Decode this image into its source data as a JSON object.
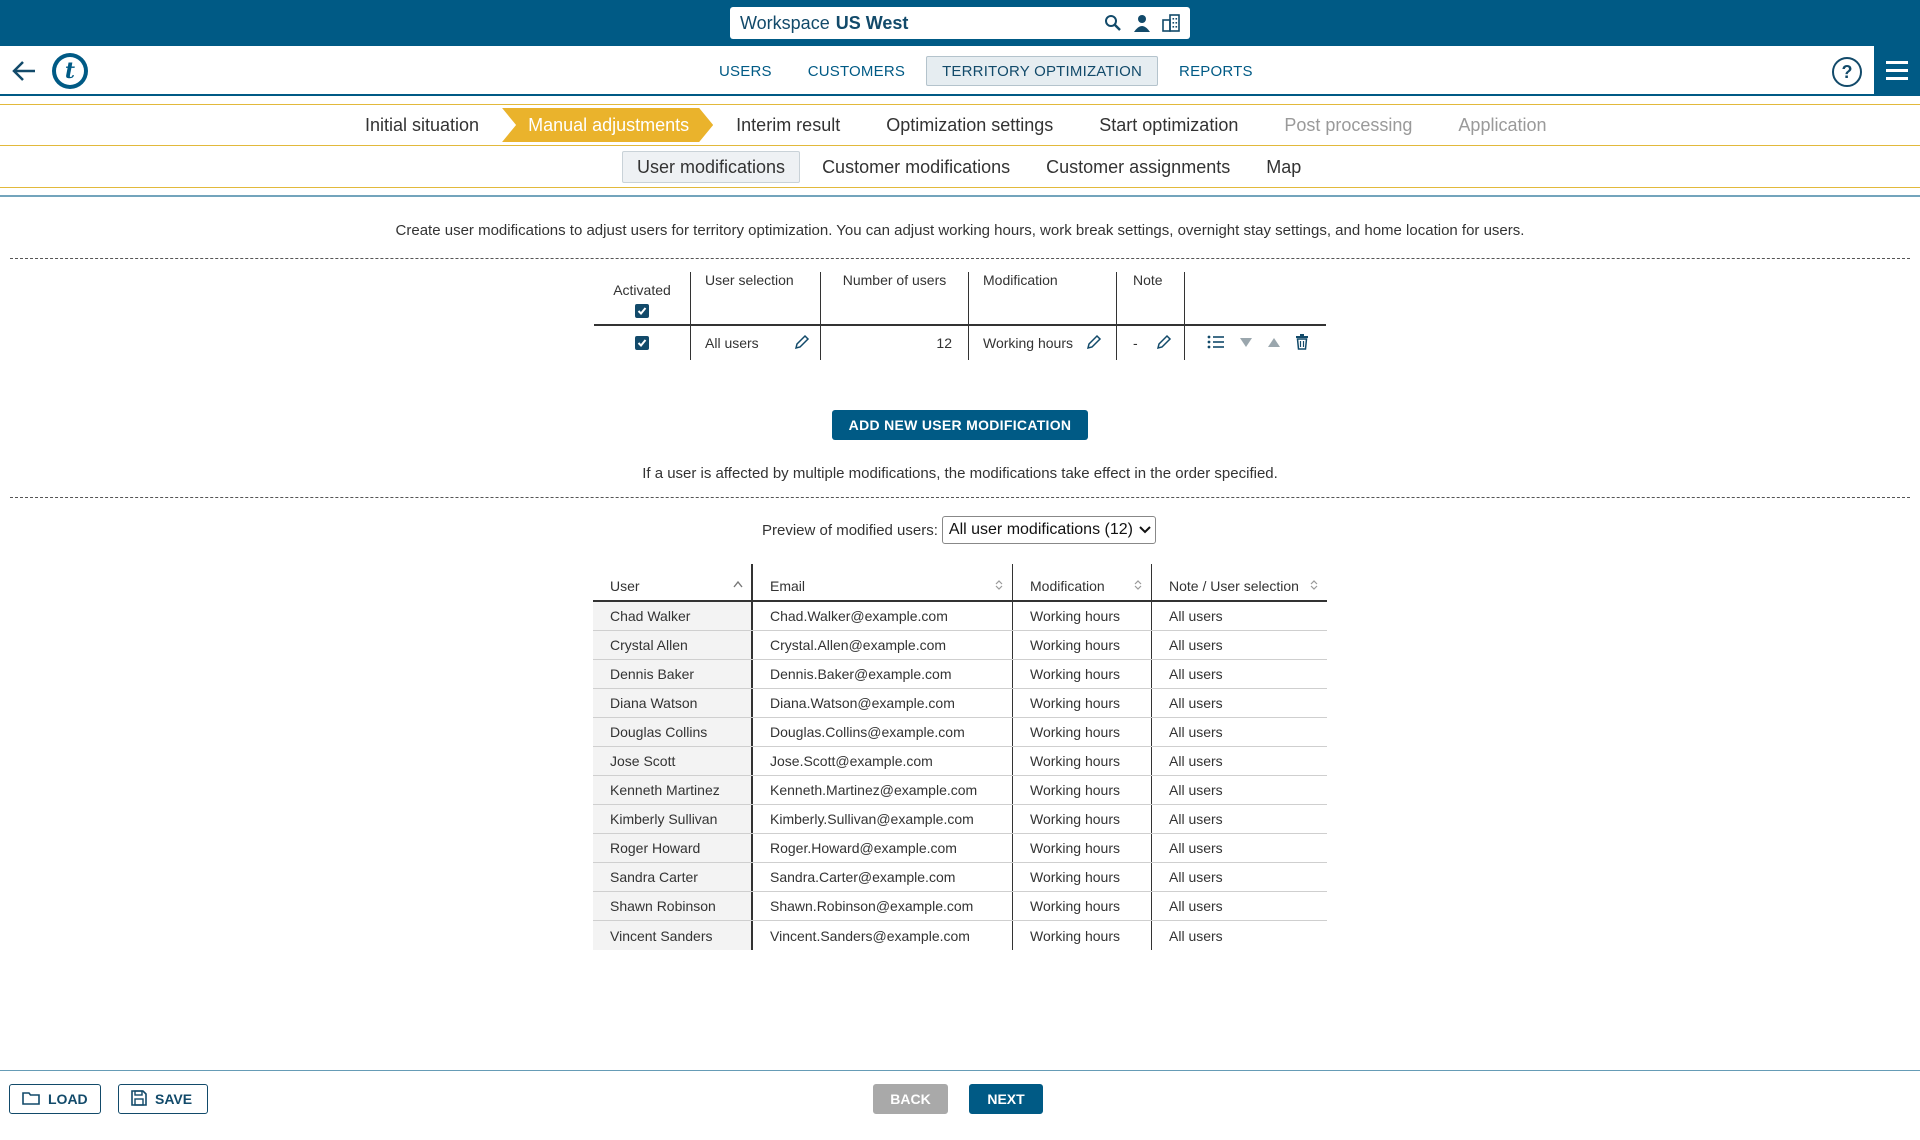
{
  "workspace": {
    "label": "Workspace",
    "name": "US West"
  },
  "icons": {
    "search": "search-icon",
    "user": "user-icon",
    "building": "building-icon",
    "back": "arrow-left-icon",
    "logo": "logo-icon",
    "help": "help-icon",
    "menu": "hamburger-menu-icon",
    "edit": "pencil-icon",
    "list": "list-icon",
    "down": "triangle-down-icon",
    "up": "triangle-up-icon",
    "delete": "trash-icon",
    "folder": "folder-icon",
    "save": "floppy-icon"
  },
  "colors": {
    "primary": "#005a85",
    "accent": "#eab32c",
    "disabled": "#a9a9a9"
  },
  "nav": {
    "help": "?",
    "items": [
      {
        "label": "USERS"
      },
      {
        "label": "CUSTOMERS"
      },
      {
        "label": "TERRITORY OPTIMIZATION"
      },
      {
        "label": "REPORTS"
      }
    ]
  },
  "steps": [
    {
      "label": "Initial situation"
    },
    {
      "label": "Manual adjustments"
    },
    {
      "label": "Interim result"
    },
    {
      "label": "Optimization settings"
    },
    {
      "label": "Start optimization"
    },
    {
      "label": "Post processing"
    },
    {
      "label": "Application"
    }
  ],
  "subtabs": [
    {
      "label": "User modifications"
    },
    {
      "label": "Customer modifications"
    },
    {
      "label": "Customer assignments"
    },
    {
      "label": "Map"
    }
  ],
  "description": "Create user modifications to adjust users for territory optimization. You can adjust working hours, work break settings, overnight stay settings, and home location for users.",
  "mod_table": {
    "headers": {
      "activated": "Activated",
      "user_selection": "User selection",
      "number_of_users": "Number of users",
      "modification": "Modification",
      "note": "Note"
    },
    "header_checked": true,
    "rows": [
      {
        "checked": true,
        "user_selection": "All users",
        "number_of_users": "12",
        "modification": "Working hours",
        "note": "-"
      }
    ]
  },
  "add_button": "ADD NEW USER MODIFICATION",
  "order_note": "If a user is affected by multiple modifications, the modifications take effect in the order specified.",
  "preview": {
    "label": "Preview of modified users:",
    "selected": "All user modifications (12)"
  },
  "users_table": {
    "headers": {
      "user": "User",
      "email": "Email",
      "modification": "Modification",
      "note": "Note / User selection"
    },
    "rows": [
      {
        "user": "Chad Walker",
        "email": "Chad.Walker@example.com",
        "modification": "Working hours",
        "note": "All users"
      },
      {
        "user": "Crystal Allen",
        "email": "Crystal.Allen@example.com",
        "modification": "Working hours",
        "note": "All users"
      },
      {
        "user": "Dennis Baker",
        "email": "Dennis.Baker@example.com",
        "modification": "Working hours",
        "note": "All users"
      },
      {
        "user": "Diana Watson",
        "email": "Diana.Watson@example.com",
        "modification": "Working hours",
        "note": "All users"
      },
      {
        "user": "Douglas Collins",
        "email": "Douglas.Collins@example.com",
        "modification": "Working hours",
        "note": "All users"
      },
      {
        "user": "Jose Scott",
        "email": "Jose.Scott@example.com",
        "modification": "Working hours",
        "note": "All users"
      },
      {
        "user": "Kenneth Martinez",
        "email": "Kenneth.Martinez@example.com",
        "modification": "Working hours",
        "note": "All users"
      },
      {
        "user": "Kimberly Sullivan",
        "email": "Kimberly.Sullivan@example.com",
        "modification": "Working hours",
        "note": "All users"
      },
      {
        "user": "Roger Howard",
        "email": "Roger.Howard@example.com",
        "modification": "Working hours",
        "note": "All users"
      },
      {
        "user": "Sandra Carter",
        "email": "Sandra.Carter@example.com",
        "modification": "Working hours",
        "note": "All users"
      },
      {
        "user": "Shawn Robinson",
        "email": "Shawn.Robinson@example.com",
        "modification": "Working hours",
        "note": "All users"
      },
      {
        "user": "Vincent Sanders",
        "email": "Vincent.Sanders@example.com",
        "modification": "Working hours",
        "note": "All users"
      }
    ]
  },
  "footer": {
    "load": "LOAD",
    "save": "SAVE",
    "back": "BACK",
    "next": "NEXT"
  }
}
